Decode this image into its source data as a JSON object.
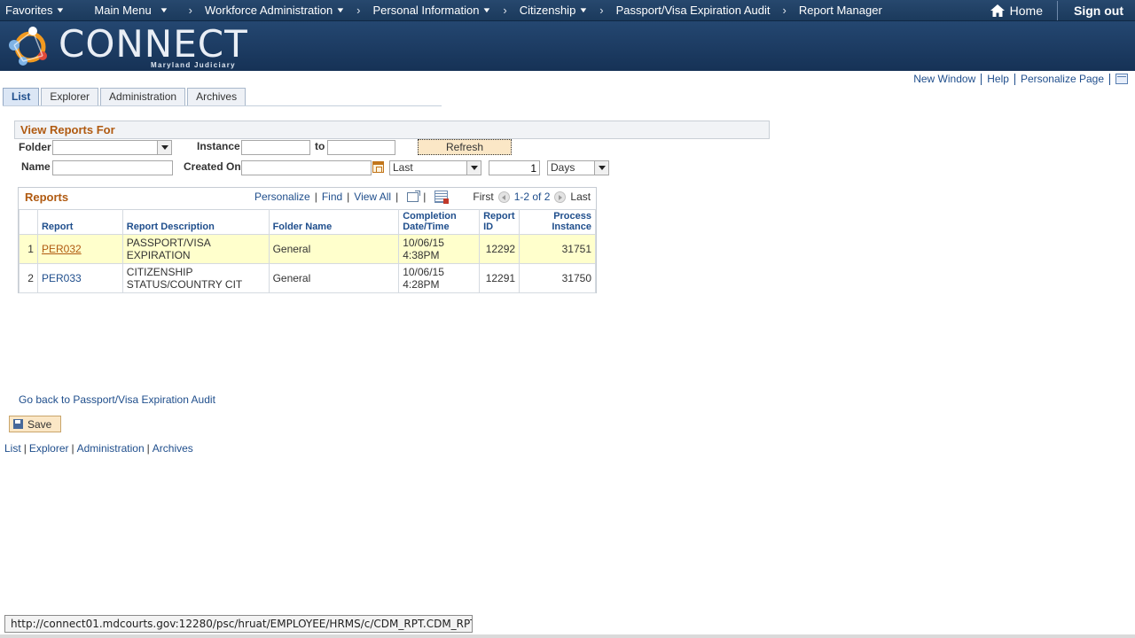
{
  "nav": {
    "favorites": "Favorites",
    "main_menu": "Main Menu",
    "breadcrumb": [
      "Workforce Administration",
      "Personal Information",
      "Citizenship",
      "Passport/Visa Expiration Audit",
      "Report Manager"
    ],
    "home": "Home",
    "sign_out": "Sign out"
  },
  "brand": {
    "name": "CONNECT",
    "sub": "Maryland Judiciary"
  },
  "page_links": {
    "new_window": "New Window",
    "help": "Help",
    "personalize_page": "Personalize Page"
  },
  "tabs": [
    "List",
    "Explorer",
    "Administration",
    "Archives"
  ],
  "filters": {
    "title": "View Reports For",
    "folder_label": "Folder",
    "folder_value": "",
    "instance_label": "Instance",
    "instance_from": "",
    "to_label": "to",
    "instance_to": "",
    "refresh": "Refresh",
    "name_label": "Name",
    "name_value": "",
    "created_on_label": "Created On",
    "created_on_value": "",
    "period_select": "Last",
    "period_count": "1",
    "period_unit": "Days"
  },
  "grid": {
    "title": "Reports",
    "personalize": "Personalize",
    "find": "Find",
    "view_all": "View All",
    "first": "First",
    "range": "1-2 of 2",
    "last": "Last",
    "columns": {
      "report": "Report",
      "description": "Report Description",
      "folder": "Folder Name",
      "completion_1": "Completion",
      "completion_2": "Date/Time",
      "report_id_1": "Report",
      "report_id_2": "ID",
      "process_1": "Process",
      "process_2": "Instance"
    },
    "rows": [
      {
        "num": "1",
        "report": "PER032",
        "desc_1": "PASSPORT/VISA",
        "desc_2": "EXPIRATION",
        "folder": "General",
        "date": "10/06/15",
        "time": "4:38PM",
        "report_id": "12292",
        "process": "31751"
      },
      {
        "num": "2",
        "report": "PER033",
        "desc_1": "CITIZENSHIP",
        "desc_2": "STATUS/COUNTRY CIT",
        "folder": "General",
        "date": "10/06/15",
        "time": "4:28PM",
        "report_id": "12291",
        "process": "31750"
      }
    ]
  },
  "footer": {
    "go_back": "Go back to Passport/Visa Expiration Audit",
    "save": "Save",
    "links": [
      "List",
      "Explorer",
      "Administration",
      "Archives"
    ]
  },
  "status_bar": "http://connect01.mdcourts.gov:12280/psc/hruat/EMPLOYEE/HRMS/c/CDM_RPT.CDM_RPT.GBL..."
}
